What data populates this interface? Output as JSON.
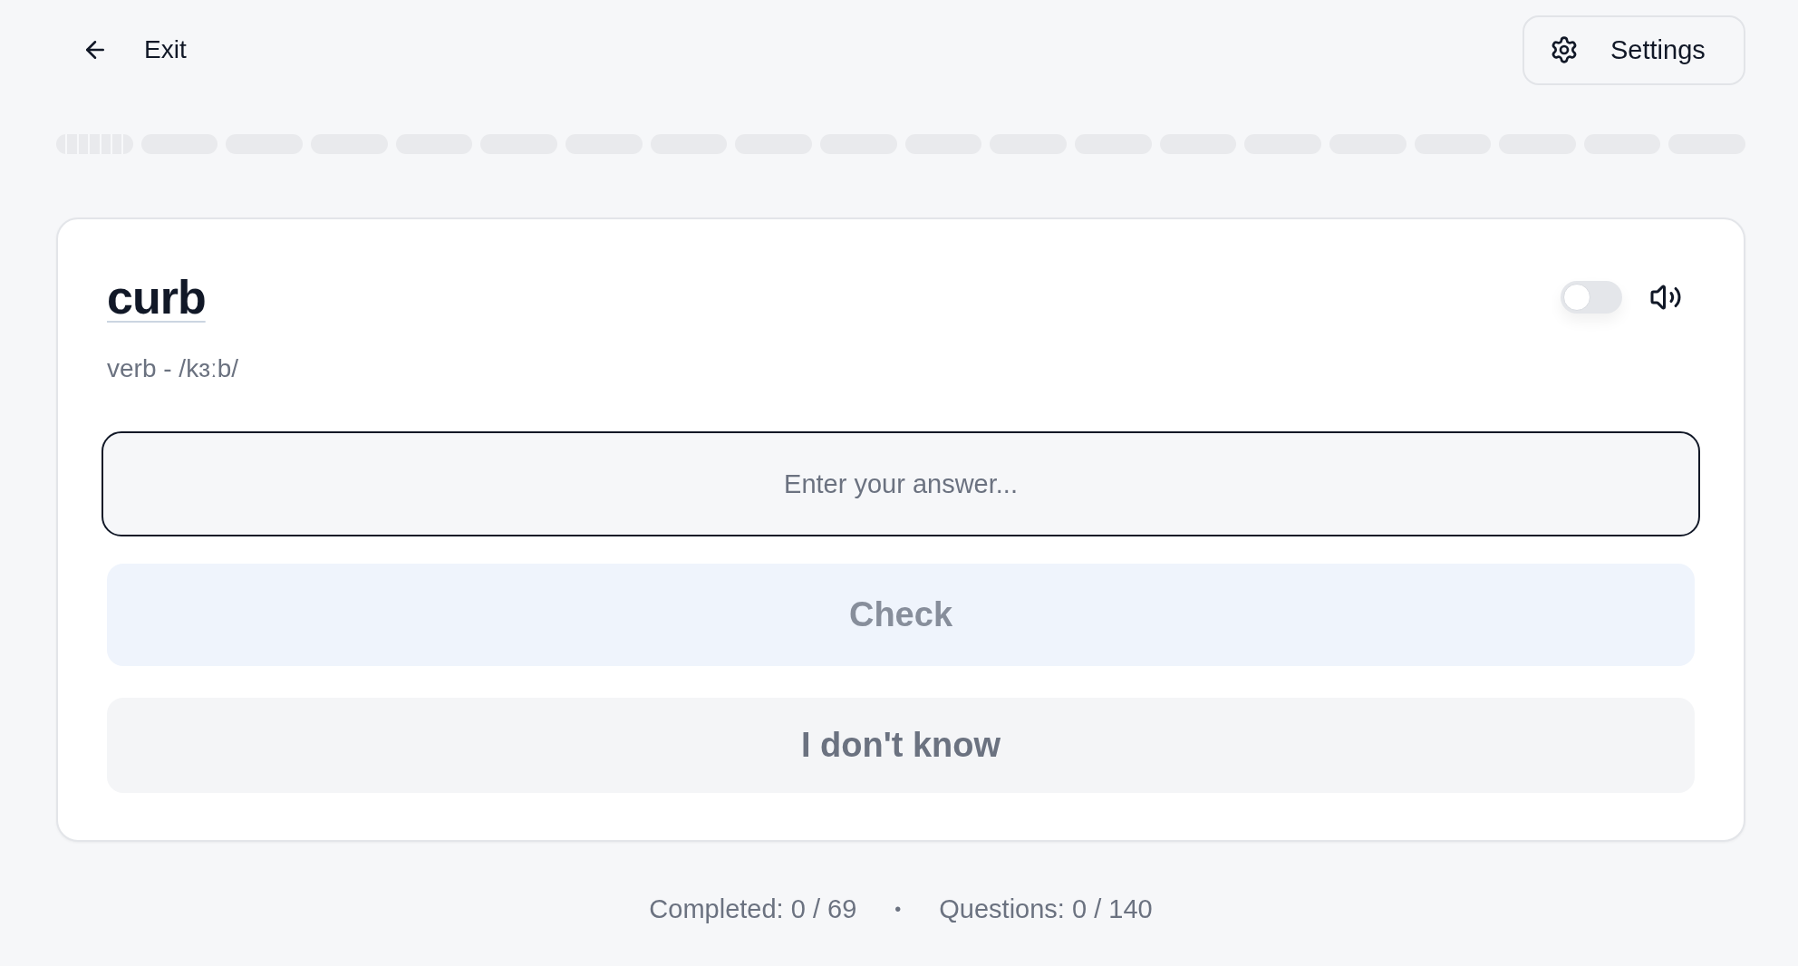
{
  "header": {
    "exit_label": "Exit",
    "settings_label": "Settings"
  },
  "progress": {
    "segments": [
      {
        "kind": "steps"
      },
      {
        "kind": "plain"
      },
      {
        "kind": "plain"
      },
      {
        "kind": "plain"
      },
      {
        "kind": "plain"
      },
      {
        "kind": "plain"
      },
      {
        "kind": "plain"
      },
      {
        "kind": "plain"
      },
      {
        "kind": "plain"
      },
      {
        "kind": "plain"
      },
      {
        "kind": "plain"
      },
      {
        "kind": "plain"
      },
      {
        "kind": "plain"
      },
      {
        "kind": "plain"
      },
      {
        "kind": "plain"
      },
      {
        "kind": "plain"
      },
      {
        "kind": "plain"
      },
      {
        "kind": "plain"
      },
      {
        "kind": "plain"
      },
      {
        "kind": "plain"
      }
    ]
  },
  "card": {
    "word": "curb",
    "details": "verb - /kɜːb/",
    "toggle": {
      "on": false
    },
    "answer": {
      "placeholder": "Enter your answer..."
    },
    "buttons": [
      {
        "kind": "check",
        "label": "Check",
        "disabled": true
      },
      {
        "kind": "skip",
        "label": "I don't know",
        "disabled": false
      }
    ]
  },
  "footer": {
    "completed": "Completed: 0 / 69",
    "separator": "•",
    "questions": "Questions: 0 / 140"
  }
}
